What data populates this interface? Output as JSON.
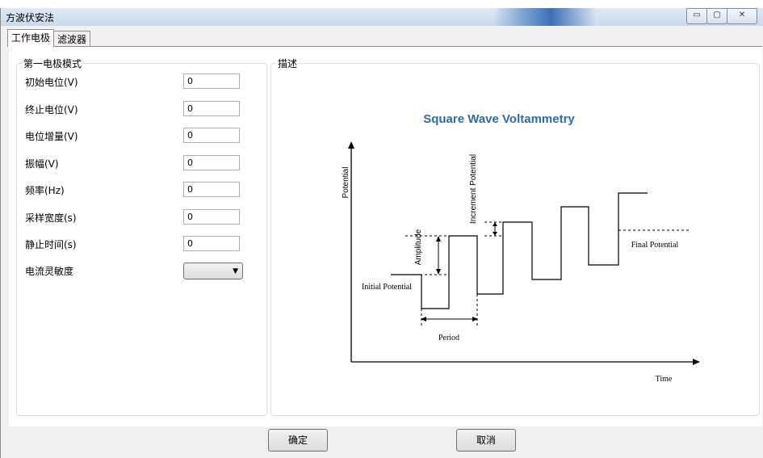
{
  "window": {
    "title": "方波伏安法",
    "buttons": [
      "▭",
      "▢",
      "✕"
    ]
  },
  "tabs": [
    {
      "label": "工作电极",
      "active": true
    },
    {
      "label": "滤波器",
      "active": false
    }
  ],
  "left_group": {
    "title": "第一电极模式",
    "fields": [
      {
        "label": "初始电位(V)",
        "value": "0"
      },
      {
        "label": "终止电位(V)",
        "value": "0"
      },
      {
        "label": "电位增量(V)",
        "value": "0"
      },
      {
        "label": "振幅(V)",
        "value": "0"
      },
      {
        "label": "频率(Hz)",
        "value": "0"
      },
      {
        "label": "采样宽度(s)",
        "value": "0"
      },
      {
        "label": "静止时间(s)",
        "value": "0"
      }
    ],
    "sensitivity": {
      "label": "电流灵敏度",
      "value": ""
    }
  },
  "right_group": {
    "title": "描述",
    "diagram": {
      "title": "Square Wave Voltammetry",
      "y_axis": "Potential",
      "x_axis": "Time",
      "labels": {
        "initial": "Initial Potential",
        "final": "Final Potential",
        "amplitude": "Amplitude",
        "increment": "Increment Potential",
        "period": "Period"
      },
      "colors": {
        "title": "#2e6ca7",
        "line": "#000000"
      }
    }
  },
  "footer": {
    "ok": "确定",
    "cancel": "取消"
  }
}
